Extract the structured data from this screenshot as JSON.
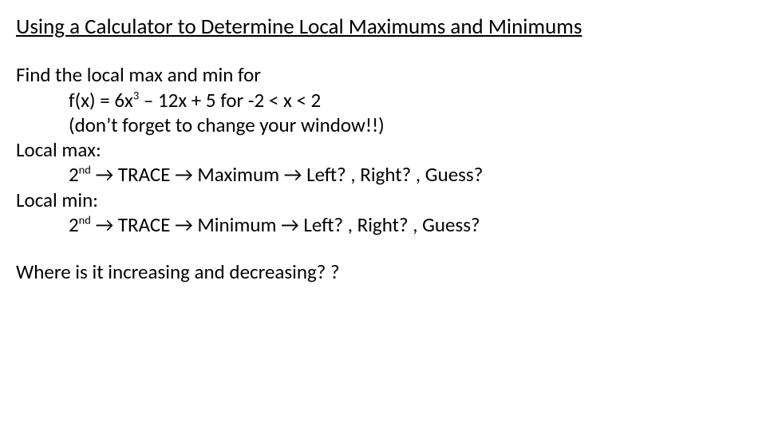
{
  "title": "Using a Calculator to Determine Local Maximums and Minimums",
  "lines": {
    "l1": "Find the local max and min for",
    "l2a": "f(x) = 6x",
    "l2sup": "3",
    "l2b": " – 12x + 5 for -2 < x < 2",
    "l3": "(don’t forget to change your window!!)",
    "l4": "Local max:",
    "l5a": "2",
    "l5sup": "nd",
    "l5b": " → TRACE → Maximum → Left? , Right? , Guess?",
    "l6": "Local min:",
    "l7a": "2",
    "l7sup": "nd",
    "l7b": " → TRACE → Minimum → Left? , Right? , Guess?",
    "l8": "Where is it increasing and decreasing? ?"
  }
}
